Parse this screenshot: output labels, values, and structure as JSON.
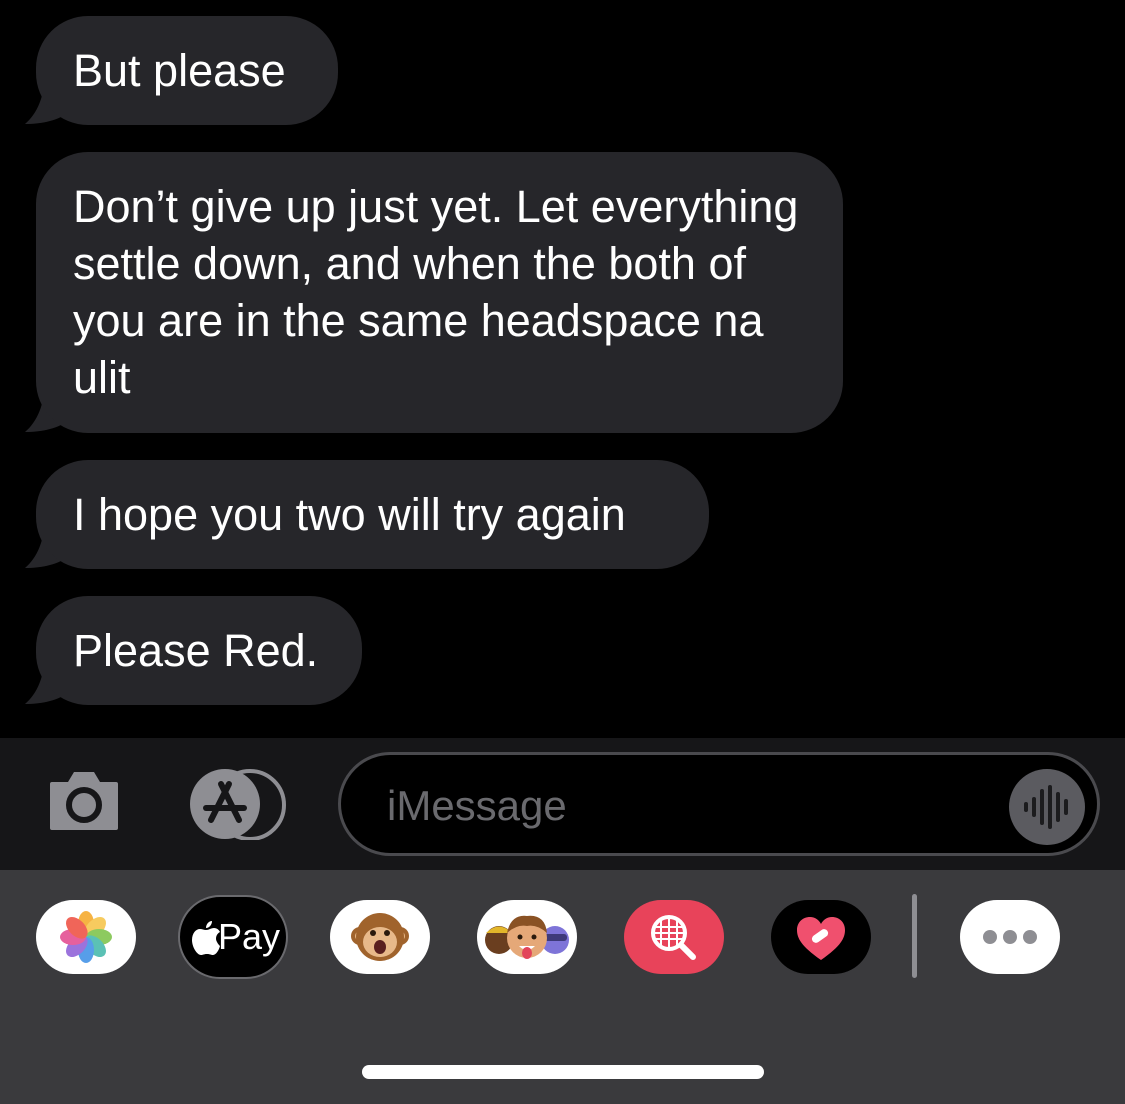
{
  "messages": [
    {
      "text": "But please"
    },
    {
      "text": "Don’t give up just yet. Let everything settle down, and when the both of you are in the same headspace na ulit"
    },
    {
      "text": "I hope you two will try again"
    },
    {
      "text": "Please Red."
    }
  ],
  "input": {
    "placeholder": "iMessage"
  },
  "drawer": {
    "apps": [
      {
        "name": "Photos"
      },
      {
        "name": "Apple Pay",
        "label": "Pay"
      },
      {
        "name": "Animoji"
      },
      {
        "name": "Memoji Stickers"
      },
      {
        "name": "Images Search"
      },
      {
        "name": "Digital Touch"
      },
      {
        "name": "More"
      }
    ]
  },
  "colors": {
    "background": "#000000",
    "bubble_received": "#26262a",
    "input_bar": "#161618",
    "drawer": "#3a3a3d",
    "placeholder": "#6a6a6e",
    "images_app": "#e8435a"
  }
}
